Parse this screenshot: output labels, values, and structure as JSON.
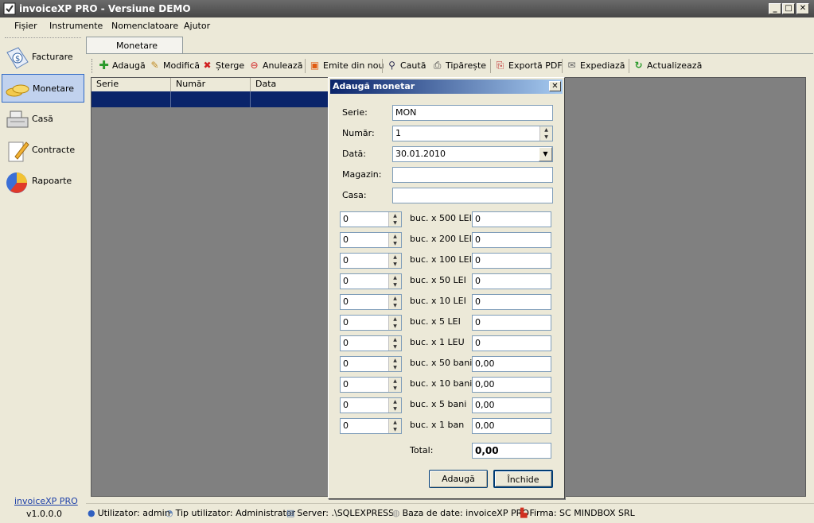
{
  "window": {
    "title": "invoiceXP PRO - Versiune DEMO"
  },
  "menu": [
    "Fișier",
    "Instrumente",
    "Nomenclatoare",
    "Ajutor"
  ],
  "sidebar": {
    "items": [
      {
        "label": "Facturare",
        "icon": "invoice-icon"
      },
      {
        "label": "Monetare",
        "icon": "coins-icon",
        "active": true
      },
      {
        "label": "Casă",
        "icon": "cash-register-icon"
      },
      {
        "label": "Contracte",
        "icon": "contract-pencil-icon"
      },
      {
        "label": "Rapoarte",
        "icon": "pie-chart-icon"
      }
    ],
    "brand_link": "invoiceXP PRO",
    "version": "v1.0.0.0"
  },
  "tab": {
    "label": "Monetare"
  },
  "toolbar": {
    "add": "Adaugă",
    "edit": "Modifică",
    "delete": "Șterge",
    "cancel": "Anulează",
    "reissue": "Emite din nou",
    "search": "Caută",
    "print": "Tipărește",
    "export_pdf": "Exportă PDF",
    "send": "Expediază",
    "refresh": "Actualizează"
  },
  "grid": {
    "columns": [
      "Serie",
      "Număr",
      "Data"
    ]
  },
  "status": {
    "user": "Utilizator: admin",
    "user_type": "Tip utilizator: Administrator",
    "server": "Server: .\\SQLEXPRESS",
    "database": "Baza de date: invoiceXP PRO",
    "company": "Firma: SC MINDBOX SRL"
  },
  "dialog": {
    "title": "Adaugă monetar",
    "serie_label": "Serie:",
    "serie_value": "MON",
    "numar_label": "Număr:",
    "numar_value": "1",
    "data_label": "Dată:",
    "data_value": "30.01.2010",
    "magazin_label": "Magazin:",
    "magazin_value": "",
    "casa_label": "Casa:",
    "casa_value": "",
    "rows": [
      {
        "qty": "0",
        "label": "buc. x 500 LEI",
        "amount": "0"
      },
      {
        "qty": "0",
        "label": "buc. x 200 LEI",
        "amount": "0"
      },
      {
        "qty": "0",
        "label": "buc. x 100 LEI",
        "amount": "0"
      },
      {
        "qty": "0",
        "label": "buc. x 50 LEI",
        "amount": "0"
      },
      {
        "qty": "0",
        "label": "buc. x 10 LEI",
        "amount": "0"
      },
      {
        "qty": "0",
        "label": "buc. x 5 LEI",
        "amount": "0"
      },
      {
        "qty": "0",
        "label": "buc. x 1 LEU",
        "amount": "0"
      },
      {
        "qty": "0",
        "label": "buc. x 50 bani",
        "amount": "0,00"
      },
      {
        "qty": "0",
        "label": "buc. x 10 bani",
        "amount": "0,00"
      },
      {
        "qty": "0",
        "label": "buc. x 5 bani",
        "amount": "0,00"
      },
      {
        "qty": "0",
        "label": "buc. x 1 ban",
        "amount": "0,00"
      }
    ],
    "total_label": "Total:",
    "total_value": "0,00",
    "add_button": "Adaugă",
    "close_button": "Închide"
  }
}
